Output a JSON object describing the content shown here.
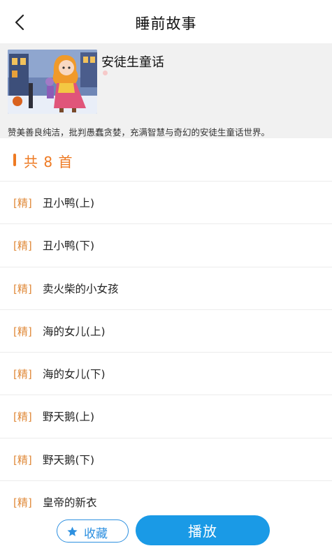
{
  "nav": {
    "title": "睡前故事"
  },
  "album": {
    "name": "安徒生童话",
    "description": "赞美善良纯洁，批判愚蠢贪婪，充满智慧与奇幻的安徒生童话世界。"
  },
  "count": {
    "text": "共 8 首"
  },
  "tag_label": "[精]",
  "stories": [
    {
      "tag": "[精]",
      "title": "丑小鸭(上)"
    },
    {
      "tag": "[精]",
      "title": "丑小鸭(下)"
    },
    {
      "tag": "[精]",
      "title": "卖火柴的小女孩"
    },
    {
      "tag": "[精]",
      "title": "海的女儿(上)"
    },
    {
      "tag": "[精]",
      "title": "海的女儿(下)"
    },
    {
      "tag": "[精]",
      "title": "野天鹅(上)"
    },
    {
      "tag": "[精]",
      "title": "野天鹅(下)"
    },
    {
      "tag": "[精]",
      "title": "皇帝的新衣"
    }
  ],
  "actions": {
    "favorite_label": "收藏",
    "play_label": "播放"
  },
  "colors": {
    "accent_orange": "#ee7a23",
    "tag_orange": "#e08a3a",
    "primary_blue": "#1a9ae6",
    "album_bg": "#f1f1f1"
  },
  "icons": {
    "back": "chevron-left-icon",
    "favorite": "star-icon"
  }
}
